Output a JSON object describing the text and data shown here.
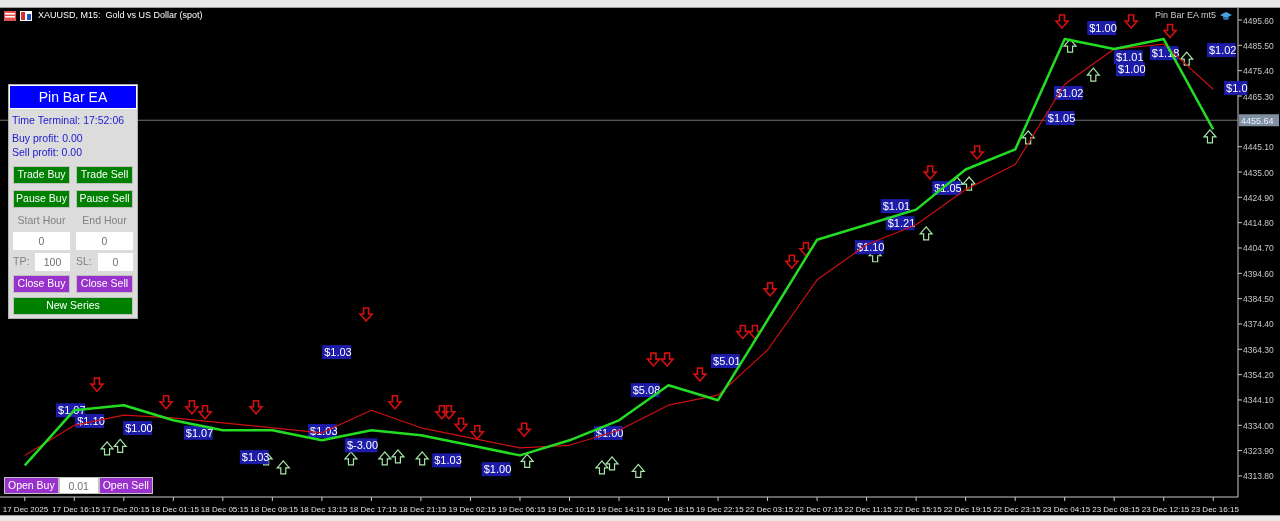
{
  "chart_window": {
    "title": "XAUUSD, M15:  Gold vs US Dollar (spot)",
    "expert_name": "Pin Bar EA mt5",
    "chart_data": {
      "type": "line",
      "ref_lines": [
        {
          "axis": "y",
          "value": 4455.64,
          "label": "4455.64"
        }
      ],
      "categories": [
        "17 Dec 2025",
        "17 Dec 16:15",
        "17 Dec 20:15",
        "18 Dec 01:15",
        "18 Dec 05:15",
        "18 Dec 09:15",
        "18 Dec 13:15",
        "18 Dec 17:15",
        "18 Dec 21:15",
        "19 Dec 02:15",
        "19 Dec 06:15",
        "19 Dec 10:15",
        "19 Dec 14:15",
        "19 Dec 18:15",
        "19 Dec 22:15",
        "22 Dec 03:15",
        "22 Dec 07:15",
        "22 Dec 11:15",
        "22 Dec 15:15",
        "22 Dec 19:15",
        "22 Dec 23:15",
        "23 Dec 04:15",
        "23 Dec 08:15",
        "23 Dec 12:15",
        "23 Dec 16:15"
      ],
      "series": [
        {
          "color": "#22dd22",
          "values": [
            4318,
            4340,
            4342,
            4336,
            4332,
            4332,
            4328,
            4332,
            4330,
            4326,
            4322,
            4328,
            4336,
            4350,
            4344,
            4376,
            4408,
            4414,
            4420,
            4436,
            4444,
            4488,
            4484,
            4488,
            4452
          ]
        },
        {
          "color": "#cc1010",
          "values": [
            4322,
            4334,
            4338,
            4337,
            4335,
            4333,
            4331,
            4340,
            4333,
            4329,
            4325,
            4326,
            4332,
            4342,
            4346,
            4364,
            4392,
            4406,
            4414,
            4428,
            4438,
            4470,
            4484,
            4486,
            4468
          ]
        }
      ],
      "ylim": [
        4305.4,
        4500.4
      ],
      "yticks": [
        {
          "value": 4313.8,
          "label": "4313.80"
        },
        {
          "value": 4323.9,
          "label": "4323.90"
        },
        {
          "value": 4334,
          "label": "4334.00"
        },
        {
          "value": 4344.1,
          "label": "4344.10"
        },
        {
          "value": 4354.2,
          "label": "4354.20"
        },
        {
          "value": 4364.3,
          "label": "4364.30"
        },
        {
          "value": 4374.4,
          "label": "4374.40"
        },
        {
          "value": 4384.5,
          "label": "4384.50"
        },
        {
          "value": 4394.6,
          "label": "4394.60"
        },
        {
          "value": 4404.7,
          "label": "4404.70"
        },
        {
          "value": 4414.8,
          "label": "4414.80"
        },
        {
          "value": 4424.9,
          "label": "4424.90"
        },
        {
          "value": 4435,
          "label": "4435.00"
        },
        {
          "value": 4445.1,
          "label": "4445.10"
        },
        {
          "value": 4465.3,
          "label": "4465.30"
        },
        {
          "value": 4475.4,
          "label": "4475.40"
        },
        {
          "value": 4485.5,
          "label": "4485.50"
        },
        {
          "value": 4495.6,
          "label": "4495.60"
        }
      ],
      "annotations": [
        "$1.07",
        "$1.10",
        "$1.00",
        "$1.07",
        "$1.03",
        "$1.03",
        "$1.03",
        "$-3.00",
        "$1.03",
        "$1.00",
        "$1.00",
        "$5.08",
        "$5.01",
        "$1.10",
        "$1.01",
        "$1.21",
        "$1.05",
        "$1.05",
        "$1.02",
        "$1.00",
        "$1.01",
        "$1.00",
        "$1.18",
        "$1.02",
        "$1.0"
      ]
    }
  },
  "panel": {
    "title": "Pin Bar EA",
    "time_terminal": "Time Terminal: 17:52:06",
    "buy_profit": "Buy profit: 0.00",
    "sell_profit": "Sell profit: 0.00",
    "trade_buttons": [
      {
        "label": "Trade Buy",
        "color": "#008000"
      },
      {
        "label": "Trade Sell",
        "color": "#008000"
      },
      {
        "label": "Pause Buy",
        "color": "#008000"
      },
      {
        "label": "Pause Sell",
        "color": "#008000"
      }
    ],
    "start_hour": {
      "label": "Start Hour",
      "value": "0"
    },
    "end_hour": {
      "label": "End Hour",
      "value": "0"
    },
    "tp": {
      "label": "TP:",
      "value": "100"
    },
    "sl": {
      "label": "SL:",
      "value": "0"
    },
    "close_buttons": [
      {
        "label": "Close Buy",
        "color": "#9932cc"
      },
      {
        "label": "Close Sell",
        "color": "#9932cc"
      }
    ],
    "new_series": "New Series"
  },
  "order_bar": {
    "open_buy": "Open Buy",
    "lot": "0.01",
    "open_sell": "Open Sell"
  }
}
